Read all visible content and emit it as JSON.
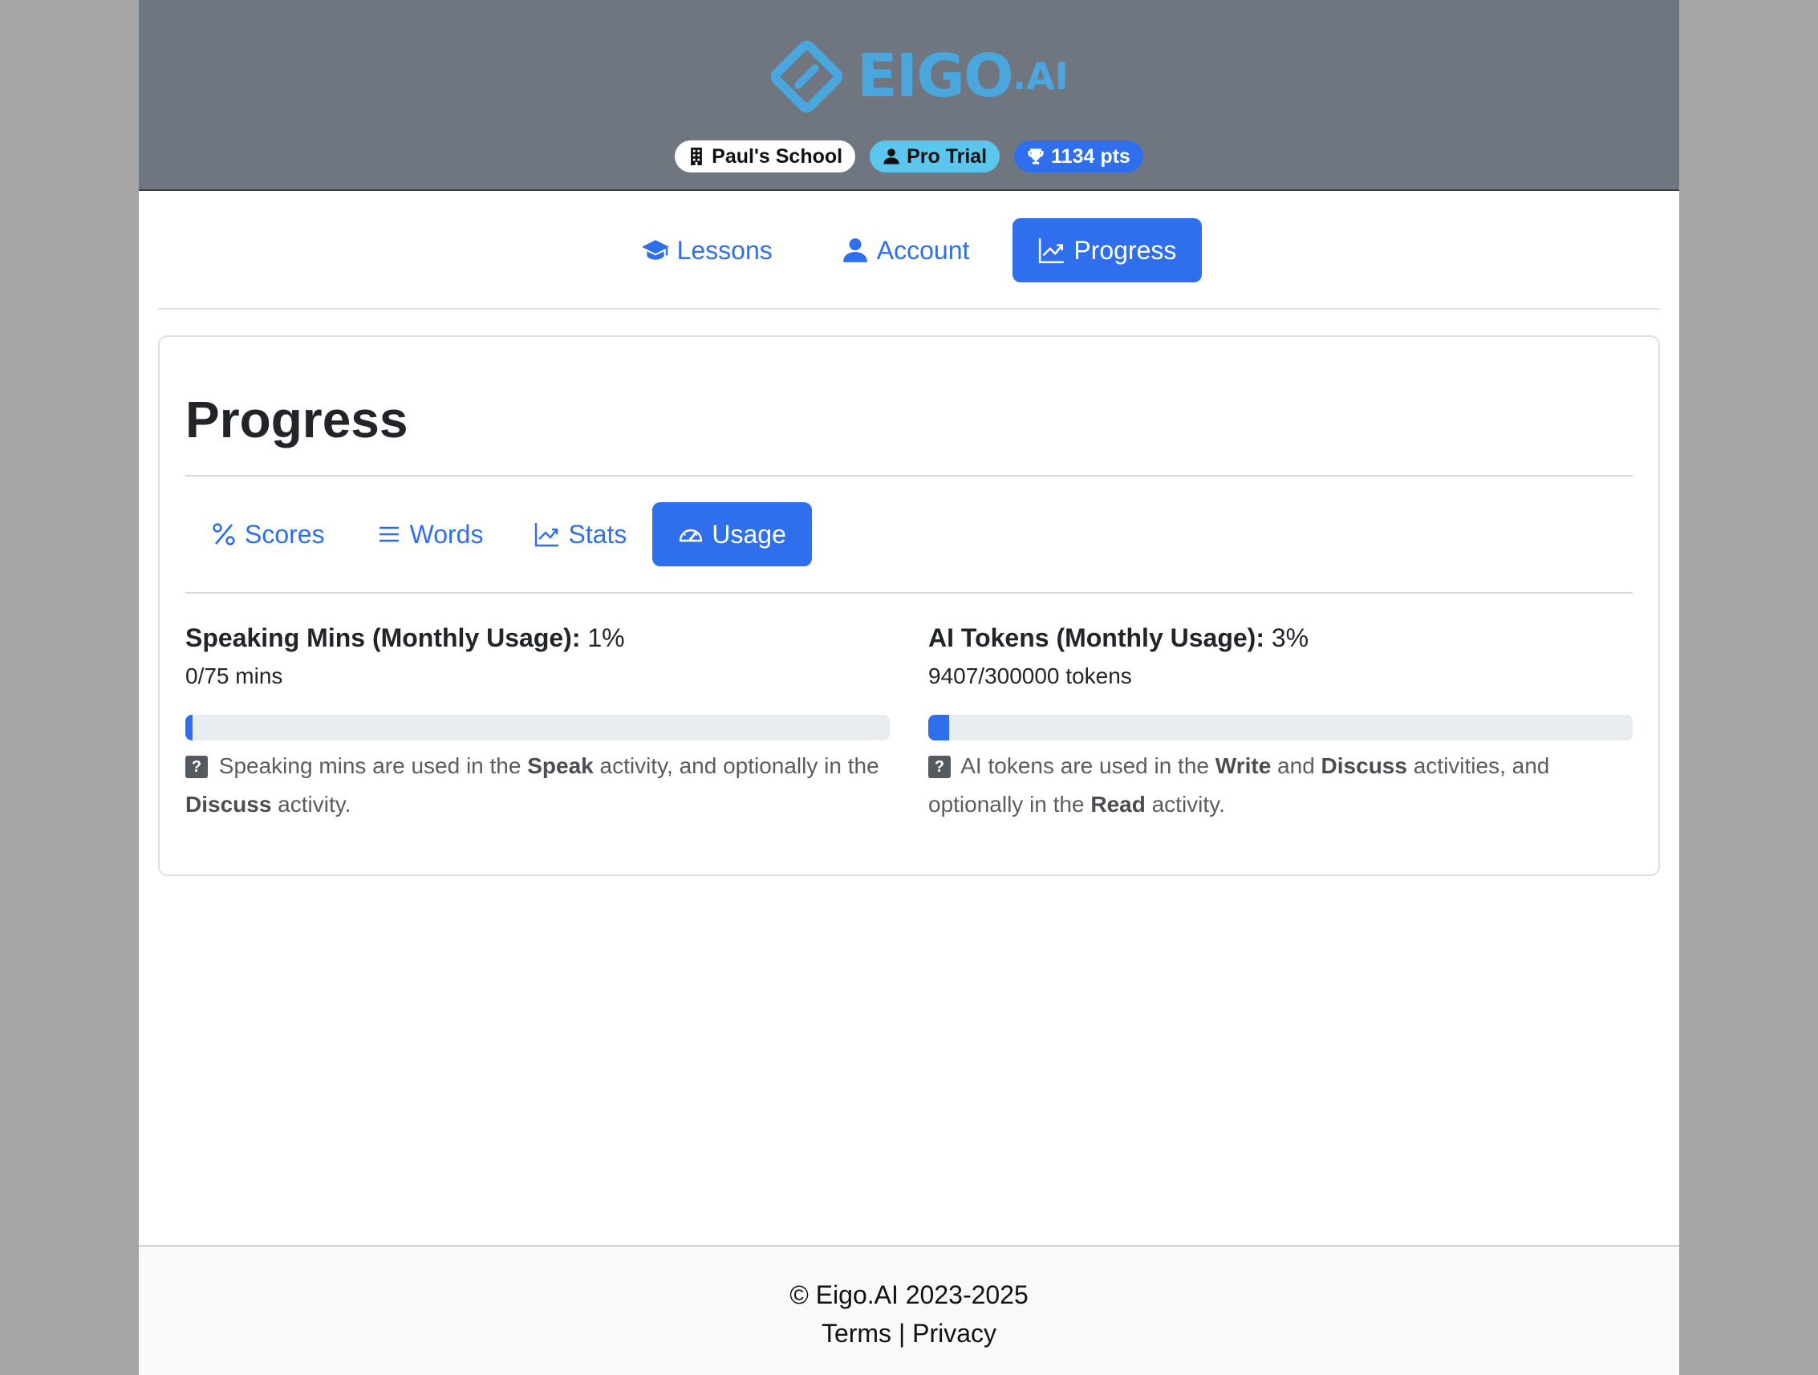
{
  "header": {
    "brand": "EIGO",
    "brand_suffix": ".AI",
    "badges": {
      "school": "Paul's School",
      "plan": "Pro Trial",
      "points": "1134 pts"
    }
  },
  "nav": {
    "lessons": "Lessons",
    "account": "Account",
    "progress": "Progress"
  },
  "main": {
    "title": "Progress",
    "tabs": {
      "scores": "Scores",
      "words": "Words",
      "stats": "Stats",
      "usage": "Usage"
    },
    "speaking": {
      "label": "Speaking Mins (Monthly Usage):",
      "percent": "1%",
      "detail": "0/75 mins",
      "fill_percent": 1,
      "note_q": "?",
      "note_1": " Speaking mins are used in the ",
      "note_b1": "Speak",
      "note_2": " activity, and optionally in the ",
      "note_b2": "Discuss",
      "note_3": " activity."
    },
    "tokens": {
      "label": "AI Tokens (Monthly Usage):",
      "percent": "3%",
      "detail": "9407/300000 tokens",
      "fill_percent": 3,
      "note_q": "?",
      "note_1": " AI tokens are used in the ",
      "note_b1": "Write",
      "note_2": " and ",
      "note_b2": "Discuss",
      "note_3": " activities, and optionally in the ",
      "note_b3": "Read",
      "note_4": " activity."
    }
  },
  "footer": {
    "copyright": "© Eigo.AI 2023-2025",
    "terms": "Terms",
    "separator": " | ",
    "privacy": "Privacy"
  },
  "colors": {
    "primary": "#2f6fed",
    "header_bg": "#6f767f",
    "logo": "#4aa6dc",
    "info_badge": "#5bc7ef"
  }
}
